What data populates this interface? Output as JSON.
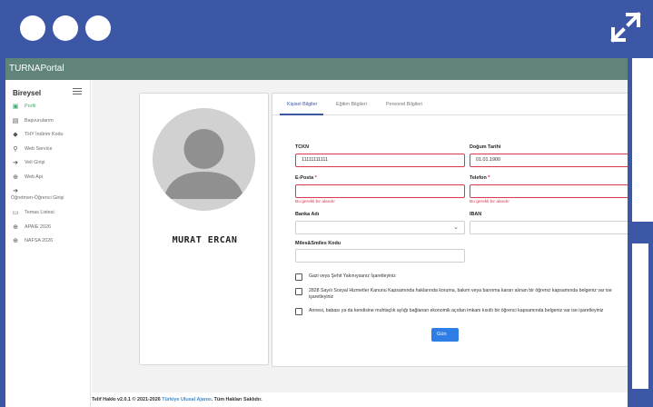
{
  "window": {
    "dot_count": 3,
    "expand_icon": "expand-arrows-icon",
    "frame_color": "#3b57a6"
  },
  "app": {
    "title": "TURNAPortal",
    "appbar_color": "#60837b"
  },
  "sidebar": {
    "header": "Bireysel",
    "menu_icon": "hamburger-icon",
    "items": [
      {
        "label": "Profil",
        "icon": "id-card-icon",
        "active": true
      },
      {
        "label": "Başvurularım",
        "icon": "clipboard-icon"
      },
      {
        "label": "THY İndirim Kodu",
        "icon": "tag-icon"
      },
      {
        "label": "Web Service",
        "icon": "plug-icon"
      },
      {
        "label": "Veli Girişi",
        "icon": "sign-in-icon"
      },
      {
        "label": "Web Api",
        "icon": "globe-icon"
      },
      {
        "label": "Öğretmen-Öğrenci Girişi",
        "icon": "sign-in-icon"
      },
      {
        "label": "Temas Listesi",
        "icon": "contact-card-icon"
      },
      {
        "label": "APAIE 2026",
        "icon": "globe-icon"
      },
      {
        "label": "NAFSA 2026",
        "icon": "globe-icon"
      }
    ]
  },
  "profile": {
    "name": "MURAT ERCAN",
    "avatar_icon": "user-avatar-icon"
  },
  "tabs": [
    {
      "label": "Kişisel Bilgiler",
      "active": true
    },
    {
      "label": "Eğitim Bilgileri"
    },
    {
      "label": "Personel Bilgileri"
    }
  ],
  "form": {
    "tckn_label": "TCKN",
    "tckn_value": "11111111111",
    "dob_label": "Doğum Tarihi",
    "dob_value": "01.01.1900",
    "email_label": "E-Posta",
    "email_value": "",
    "email_error": "Bu gerekli bir alandır",
    "phone_label": "Telefon",
    "phone_value": "",
    "phone_error": "Bu gerekli bir alandır",
    "required_mark": "*",
    "bank_label": "Banka Adı",
    "bank_value": "",
    "iban_label": "IBAN",
    "iban_value": "",
    "miles_label": "Miles&Smiles Kodu",
    "miles_value": "",
    "checkboxes": [
      {
        "label": "Gazi veya Şehit Yakınıysanız İşaretleyiniz",
        "checked": false
      },
      {
        "label": "2828 Sayılı Sosyal Hizmetler Kanunu Kapsamında haklarında koruma, bakım veya barınma kararı alınan bir öğrenci kapsamında belgeniz var ise işaretleyiniz",
        "checked": false
      },
      {
        "label": "Annesi, babası ya da kendisine muhtaçlık aylığı bağlanan ekonomik açıdan imkanı kısıtlı bir öğrenci kapsamında belgeniz var ise işaretleyiniz",
        "checked": false
      }
    ],
    "save_label": "Gün",
    "error_color": "#d33a4a",
    "accent_color": "#2f7ee5"
  },
  "footer": {
    "prefix": "Telif Hakkı v2.0.1 © 2021-2026",
    "link": "Türkiye Ulusal Ajansı",
    "suffix": ". Tüm Hakları Saklıdır."
  }
}
